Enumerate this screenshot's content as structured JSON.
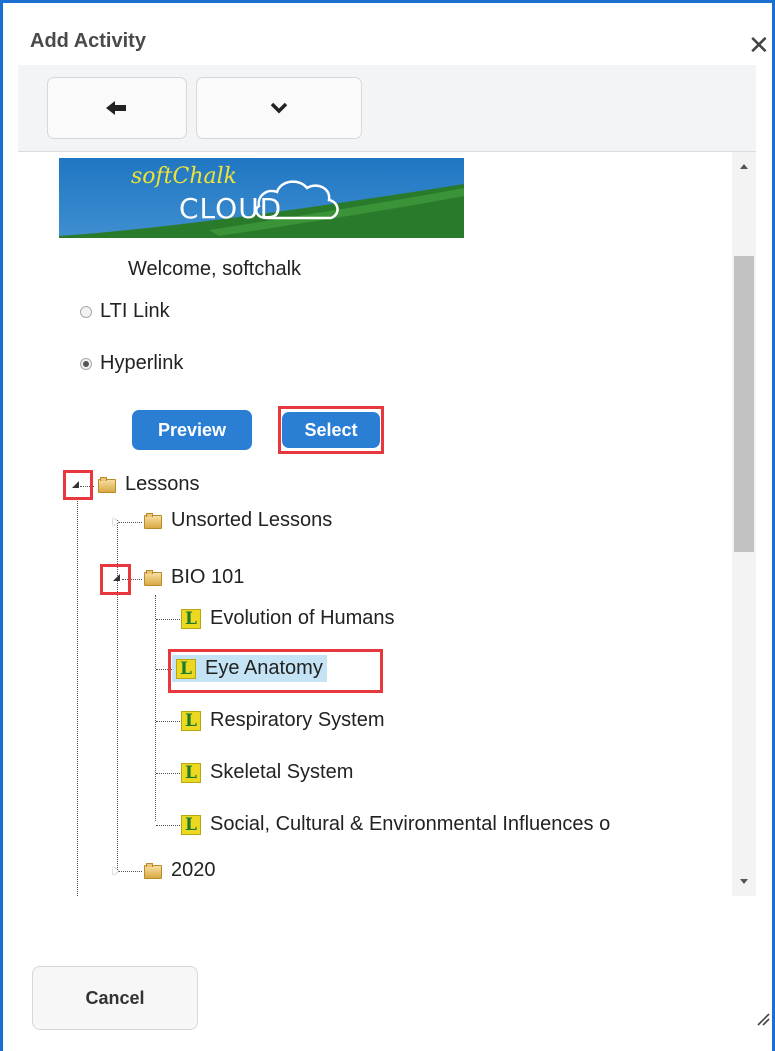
{
  "dialog": {
    "title": "Add Activity",
    "close_icon": "close-icon",
    "toolbar": {
      "back_icon": "arrow-left-icon",
      "more_icon": "chevron-down-icon"
    }
  },
  "content": {
    "logo": {
      "word1": "softChalk",
      "word2": "CLOUD",
      "colors": {
        "sky": "#1c6fba",
        "grass": "#2a7a2c",
        "text": "#f0e236"
      }
    },
    "welcome": "Welcome, softchalk",
    "radio_options": [
      {
        "label": "LTI Link",
        "checked": false
      },
      {
        "label": "Hyperlink",
        "checked": true
      }
    ],
    "buttons": {
      "preview": "Preview",
      "select": "Select"
    },
    "tree": {
      "root": "Lessons",
      "unsorted": "Unsorted Lessons",
      "course": "BIO 101",
      "lessons": [
        "Evolution of Humans",
        "Eye Anatomy",
        "Respiratory System",
        "Skeletal System",
        "Social, Cultural & Environmental Influences o"
      ],
      "selected": "Eye Anatomy",
      "year": "2020"
    }
  },
  "footer": {
    "cancel": "Cancel"
  },
  "colors": {
    "accent": "#2a7fd4",
    "highlight": "#e8383e",
    "selection": "#c4e4f6",
    "frame": "#1a6fd0"
  }
}
